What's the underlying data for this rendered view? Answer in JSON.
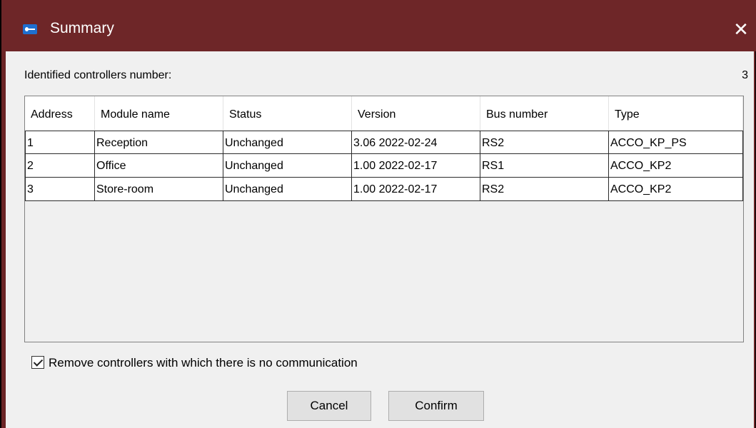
{
  "window": {
    "title": "Summary",
    "close_symbol": "✕"
  },
  "identified": {
    "label": "Identified controllers number:",
    "count": "3"
  },
  "table": {
    "headers": [
      "Address",
      "Module name",
      "Status",
      "Version",
      "Bus number",
      "Type"
    ],
    "rows": [
      [
        "1",
        "Reception",
        "Unchanged",
        "3.06 2022-02-24",
        "RS2",
        "ACCO_KP_PS"
      ],
      [
        "2",
        "Office",
        "Unchanged",
        "1.00 2022-02-17",
        "RS1",
        "ACCO_KP2"
      ],
      [
        "3",
        "Store-room",
        "Unchanged",
        "1.00 2022-02-17",
        "RS2",
        "ACCO_KP2"
      ]
    ]
  },
  "remove_option": {
    "label": "Remove controllers with which there is no communication",
    "checked": true
  },
  "buttons": {
    "cancel": "Cancel",
    "confirm": "Confirm"
  },
  "icons": {
    "app": "app-icon",
    "close": "close-icon",
    "check": "checkbox-check-icon"
  },
  "colors": {
    "titlebar": "#6e2628",
    "background": "#f0f0f0",
    "button": "#e1e1e1"
  }
}
